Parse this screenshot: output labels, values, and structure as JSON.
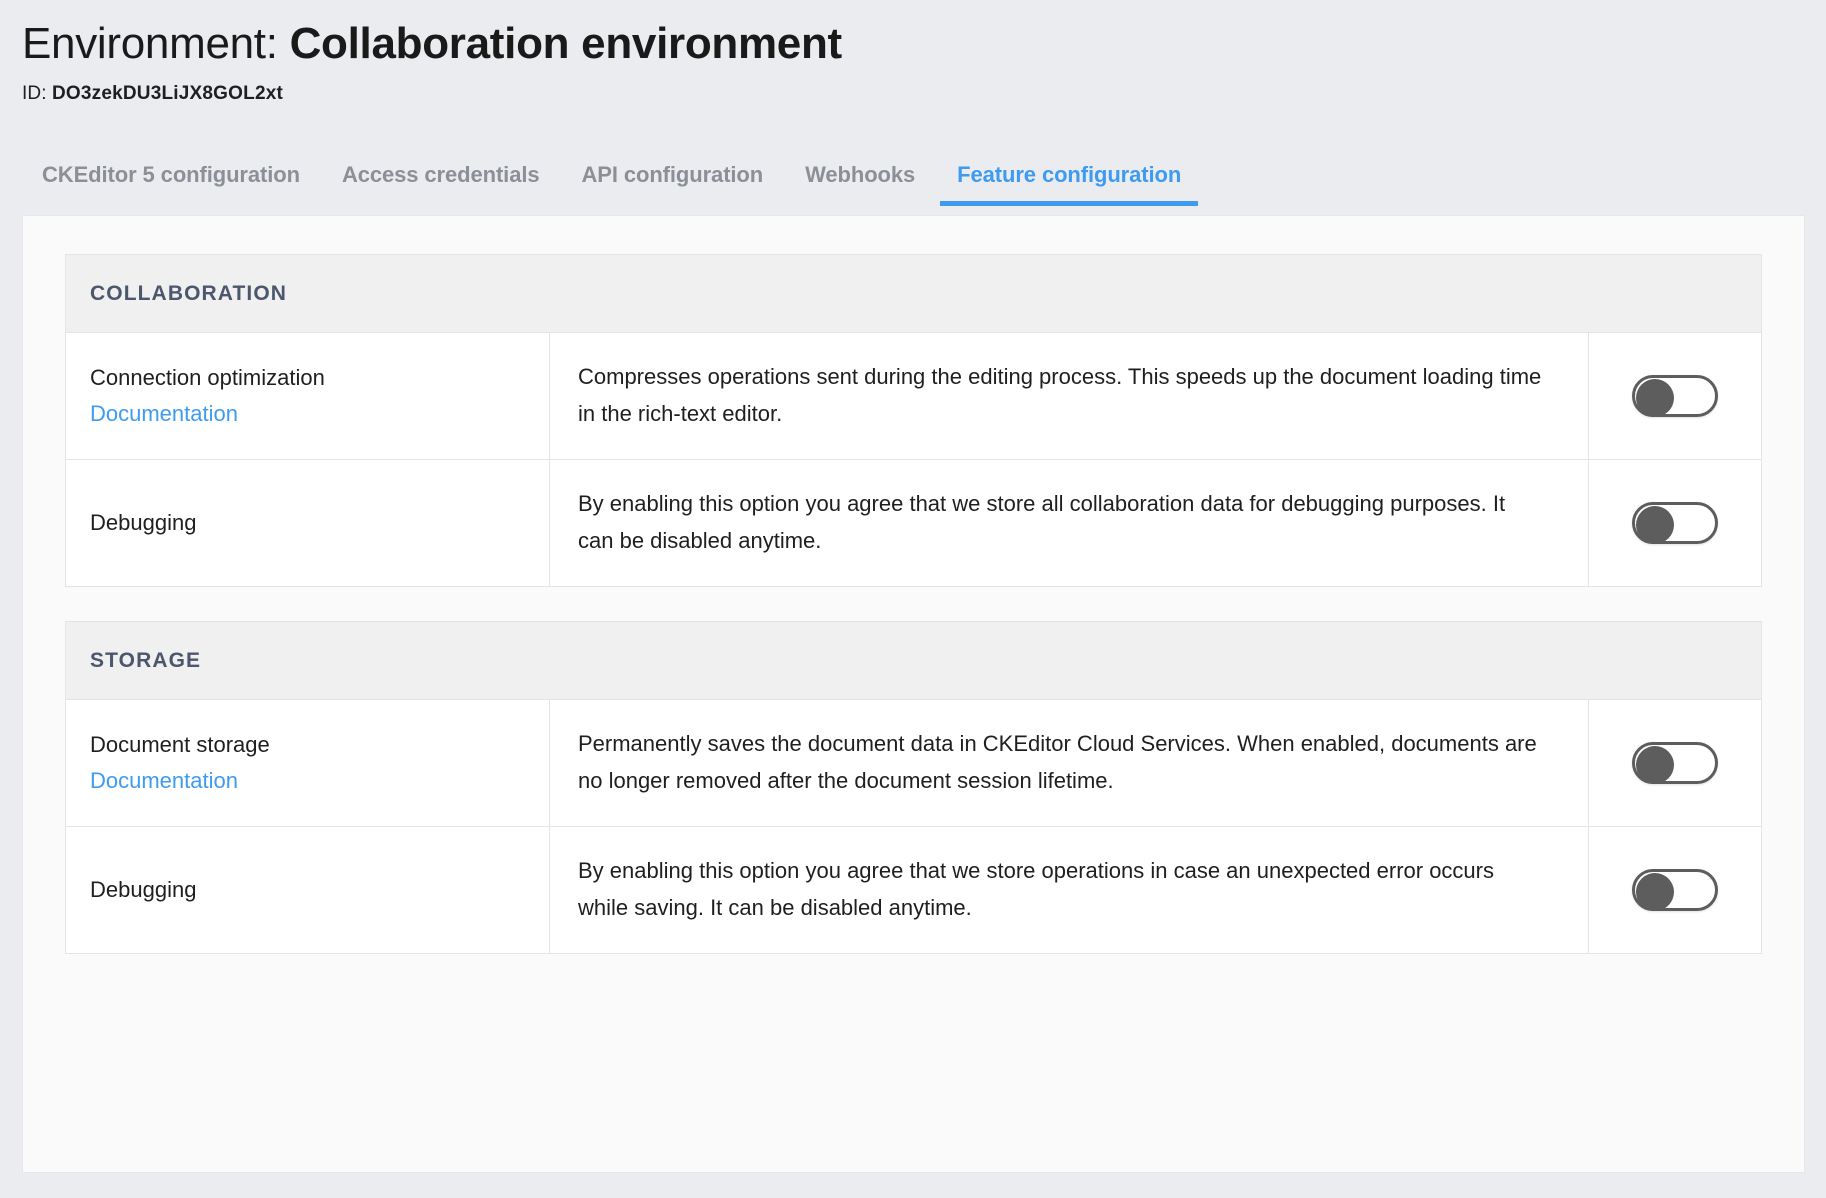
{
  "header": {
    "title_prefix": "Environment:",
    "title_name": "Collaboration environment",
    "id_label": "ID:",
    "id_value": "DO3zekDU3LiJX8GOL2xt"
  },
  "tabs": [
    {
      "label": "CKEditor 5 configuration",
      "active": false
    },
    {
      "label": "Access credentials",
      "active": false
    },
    {
      "label": "API configuration",
      "active": false
    },
    {
      "label": "Webhooks",
      "active": false
    },
    {
      "label": "Feature configuration",
      "active": true
    }
  ],
  "colors": {
    "accent": "#3e9bf0",
    "page_background": "#eaecf0",
    "card_background": "#fafafa",
    "section_header_background": "#f0f0f1",
    "section_header_text": "#4c566d",
    "toggle_off": "#5d5d5d"
  },
  "sections": [
    {
      "title": "COLLABORATION",
      "rows": [
        {
          "name": "Connection optimization",
          "doc_link": "Documentation",
          "description": "Compresses operations sent during the editing process. This speeds up the document loading time in the rich-text editor.",
          "toggle_state": "off"
        },
        {
          "name": "Debugging",
          "doc_link": null,
          "description": "By enabling this option you agree that we store all collaboration data for debugging purposes. It can be disabled anytime.",
          "toggle_state": "off"
        }
      ]
    },
    {
      "title": "STORAGE",
      "rows": [
        {
          "name": "Document storage",
          "doc_link": "Documentation",
          "description": "Permanently saves the document data in CKEditor Cloud Services. When enabled, documents are no longer removed after the document session lifetime.",
          "toggle_state": "off"
        },
        {
          "name": "Debugging",
          "doc_link": null,
          "description": "By enabling this option you agree that we store operations in case an unexpected error occurs while saving. It can be disabled anytime.",
          "toggle_state": "off"
        }
      ]
    }
  ]
}
